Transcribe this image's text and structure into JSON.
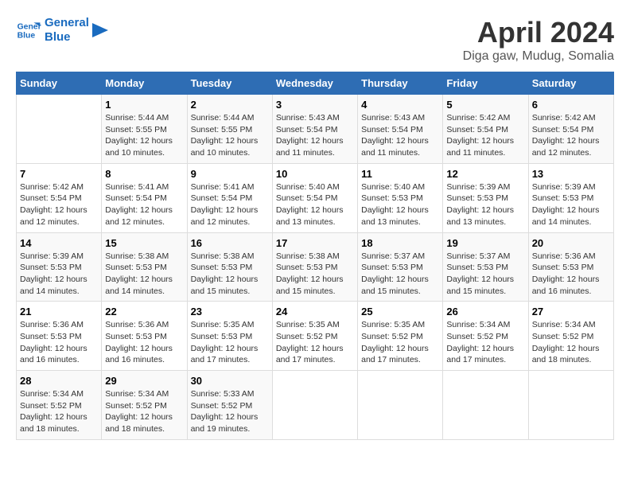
{
  "logo": {
    "line1": "General",
    "line2": "Blue"
  },
  "title": "April 2024",
  "location": "Diga gaw, Mudug, Somalia",
  "weekdays": [
    "Sunday",
    "Monday",
    "Tuesday",
    "Wednesday",
    "Thursday",
    "Friday",
    "Saturday"
  ],
  "weeks": [
    [
      {
        "day": "",
        "info": ""
      },
      {
        "day": "1",
        "info": "Sunrise: 5:44 AM\nSunset: 5:55 PM\nDaylight: 12 hours\nand 10 minutes."
      },
      {
        "day": "2",
        "info": "Sunrise: 5:44 AM\nSunset: 5:55 PM\nDaylight: 12 hours\nand 10 minutes."
      },
      {
        "day": "3",
        "info": "Sunrise: 5:43 AM\nSunset: 5:54 PM\nDaylight: 12 hours\nand 11 minutes."
      },
      {
        "day": "4",
        "info": "Sunrise: 5:43 AM\nSunset: 5:54 PM\nDaylight: 12 hours\nand 11 minutes."
      },
      {
        "day": "5",
        "info": "Sunrise: 5:42 AM\nSunset: 5:54 PM\nDaylight: 12 hours\nand 11 minutes."
      },
      {
        "day": "6",
        "info": "Sunrise: 5:42 AM\nSunset: 5:54 PM\nDaylight: 12 hours\nand 12 minutes."
      }
    ],
    [
      {
        "day": "7",
        "info": "Sunrise: 5:42 AM\nSunset: 5:54 PM\nDaylight: 12 hours\nand 12 minutes."
      },
      {
        "day": "8",
        "info": "Sunrise: 5:41 AM\nSunset: 5:54 PM\nDaylight: 12 hours\nand 12 minutes."
      },
      {
        "day": "9",
        "info": "Sunrise: 5:41 AM\nSunset: 5:54 PM\nDaylight: 12 hours\nand 12 minutes."
      },
      {
        "day": "10",
        "info": "Sunrise: 5:40 AM\nSunset: 5:54 PM\nDaylight: 12 hours\nand 13 minutes."
      },
      {
        "day": "11",
        "info": "Sunrise: 5:40 AM\nSunset: 5:53 PM\nDaylight: 12 hours\nand 13 minutes."
      },
      {
        "day": "12",
        "info": "Sunrise: 5:39 AM\nSunset: 5:53 PM\nDaylight: 12 hours\nand 13 minutes."
      },
      {
        "day": "13",
        "info": "Sunrise: 5:39 AM\nSunset: 5:53 PM\nDaylight: 12 hours\nand 14 minutes."
      }
    ],
    [
      {
        "day": "14",
        "info": "Sunrise: 5:39 AM\nSunset: 5:53 PM\nDaylight: 12 hours\nand 14 minutes."
      },
      {
        "day": "15",
        "info": "Sunrise: 5:38 AM\nSunset: 5:53 PM\nDaylight: 12 hours\nand 14 minutes."
      },
      {
        "day": "16",
        "info": "Sunrise: 5:38 AM\nSunset: 5:53 PM\nDaylight: 12 hours\nand 15 minutes."
      },
      {
        "day": "17",
        "info": "Sunrise: 5:38 AM\nSunset: 5:53 PM\nDaylight: 12 hours\nand 15 minutes."
      },
      {
        "day": "18",
        "info": "Sunrise: 5:37 AM\nSunset: 5:53 PM\nDaylight: 12 hours\nand 15 minutes."
      },
      {
        "day": "19",
        "info": "Sunrise: 5:37 AM\nSunset: 5:53 PM\nDaylight: 12 hours\nand 15 minutes."
      },
      {
        "day": "20",
        "info": "Sunrise: 5:36 AM\nSunset: 5:53 PM\nDaylight: 12 hours\nand 16 minutes."
      }
    ],
    [
      {
        "day": "21",
        "info": "Sunrise: 5:36 AM\nSunset: 5:53 PM\nDaylight: 12 hours\nand 16 minutes."
      },
      {
        "day": "22",
        "info": "Sunrise: 5:36 AM\nSunset: 5:53 PM\nDaylight: 12 hours\nand 16 minutes."
      },
      {
        "day": "23",
        "info": "Sunrise: 5:35 AM\nSunset: 5:53 PM\nDaylight: 12 hours\nand 17 minutes."
      },
      {
        "day": "24",
        "info": "Sunrise: 5:35 AM\nSunset: 5:52 PM\nDaylight: 12 hours\nand 17 minutes."
      },
      {
        "day": "25",
        "info": "Sunrise: 5:35 AM\nSunset: 5:52 PM\nDaylight: 12 hours\nand 17 minutes."
      },
      {
        "day": "26",
        "info": "Sunrise: 5:34 AM\nSunset: 5:52 PM\nDaylight: 12 hours\nand 17 minutes."
      },
      {
        "day": "27",
        "info": "Sunrise: 5:34 AM\nSunset: 5:52 PM\nDaylight: 12 hours\nand 18 minutes."
      }
    ],
    [
      {
        "day": "28",
        "info": "Sunrise: 5:34 AM\nSunset: 5:52 PM\nDaylight: 12 hours\nand 18 minutes."
      },
      {
        "day": "29",
        "info": "Sunrise: 5:34 AM\nSunset: 5:52 PM\nDaylight: 12 hours\nand 18 minutes."
      },
      {
        "day": "30",
        "info": "Sunrise: 5:33 AM\nSunset: 5:52 PM\nDaylight: 12 hours\nand 19 minutes."
      },
      {
        "day": "",
        "info": ""
      },
      {
        "day": "",
        "info": ""
      },
      {
        "day": "",
        "info": ""
      },
      {
        "day": "",
        "info": ""
      }
    ]
  ]
}
